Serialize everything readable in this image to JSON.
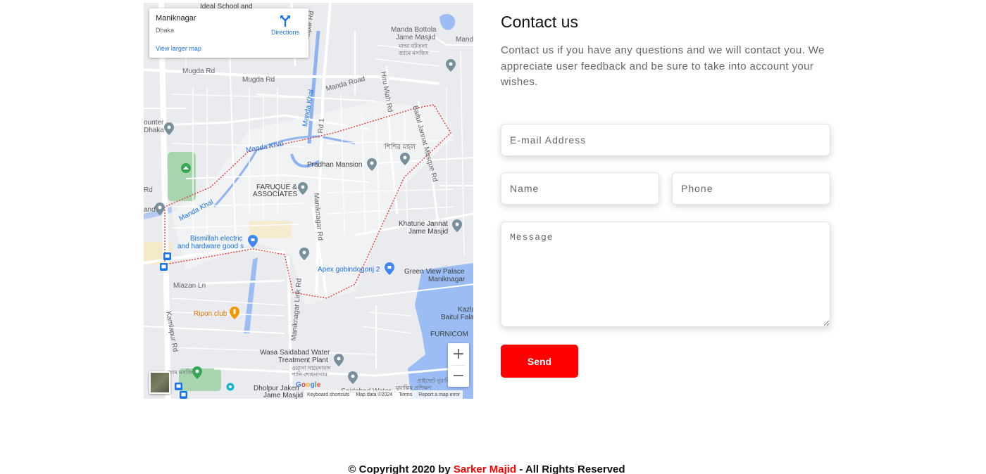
{
  "map": {
    "info_card": {
      "place_name": "Maniknagar",
      "region": "Dhaka",
      "directions_label": "Directions",
      "view_larger_label": "View larger map"
    },
    "labels": {
      "ideal_school": "Ideal School and",
      "manda_bottola_1": "Manda Bottola",
      "manda_bottola_2": "Jame Masjid",
      "manda_bottola_bn_1": "মান্ডা বটতলা",
      "manda_bottola_bn_2": "জামে মসজিদ",
      "manda": "Manda",
      "mugda_rd_1": "Mugda Rd",
      "mugda_rd_2": "Mugda Rd",
      "manda_road": "Manda Road",
      "khalpar_rd": "Khalpar Rd",
      "manda_khal_1": "Manda Khal",
      "manda_khal_2": "Manda Khal",
      "manda_khal_3": "Manda Khal",
      "hiru_miah_rd": "Hiru Miah Rd",
      "baitul_jannat_rd": "Baitul Jannat Mosque Rd",
      "rd_1": "Rd 1",
      "counter_1": "ounter",
      "counter_2": "Dhaka",
      "shishir_mohol": "শিশির মহল",
      "pradhan_mansion": "Pradhan Mansion",
      "faruque_1": "FARUQUE &",
      "faruque_2": "ASSOCIATES",
      "maniknagar_rd": "Maniknagar Rd",
      "khatune_jannat_1": "Khatune Jannat",
      "khatune_jannat_2": "Jame Masjid",
      "bismillah_1": "Bismillah electric",
      "bismillah_2": "and hardware good s",
      "apex": "Apex gobindogonj 2",
      "green_view_1": "Green View Palace",
      "green_view_2": "Maniknagar",
      "miazan_ln": "Miazan Ln",
      "maniknagar_link_rd": "Maniknagar Link Rd",
      "kamlapur_rd": "Kamlapur Rd",
      "ripon_club": "Ripon club",
      "kazla_1": "Kazla",
      "kazla_2": "Baitul Fala",
      "furnicom": "FURNICOM",
      "wasa_1": "Wasa Saidabad Water",
      "wasa_2": "Treatment Plant",
      "wasa_bn_1": "ওয়াসা সায়েদাবাদ",
      "wasa_bn_2": "পানি শোধনাগার",
      "dholpur_1": "Dholpur Jakeri",
      "dholpur_2": "Jame Masjid",
      "saidabad": "Saidabad Water",
      "bn_training_1": "প্রাইভেট নুরানি",
      "bn_training_2": "মুয়াল্লিম প্রশিক্ষণ",
      "rd_left": "Rd",
      "and_left": "and",
      "bn_masjid_bottom": "জাম মসজিদ"
    },
    "zoom_in_label": "+",
    "zoom_out_label": "−",
    "google_logo": "Google",
    "attribution": {
      "shortcuts": "Keyboard shortcuts",
      "map_data": "Map data ©2024",
      "terms": "Terms",
      "report": "Report a map error"
    }
  },
  "contact": {
    "title": "Contact us",
    "description": "Contact us if you have any questions and we will contact you. We appreciate user feedback and be sure to take into account your wishes.",
    "email_placeholder": "E-mail Address",
    "name_placeholder": "Name",
    "phone_placeholder": "Phone",
    "message_placeholder": "Message",
    "send_label": "Send"
  },
  "footer": {
    "prefix": "© Copyright 2020 by",
    "author": "Sarker Majid",
    "suffix": "- All Rights Reserved"
  },
  "colors": {
    "accent": "#ff0000",
    "map_water": "#9cbcf4",
    "map_park": "#a8d5b0",
    "map_route": "#e53935"
  }
}
